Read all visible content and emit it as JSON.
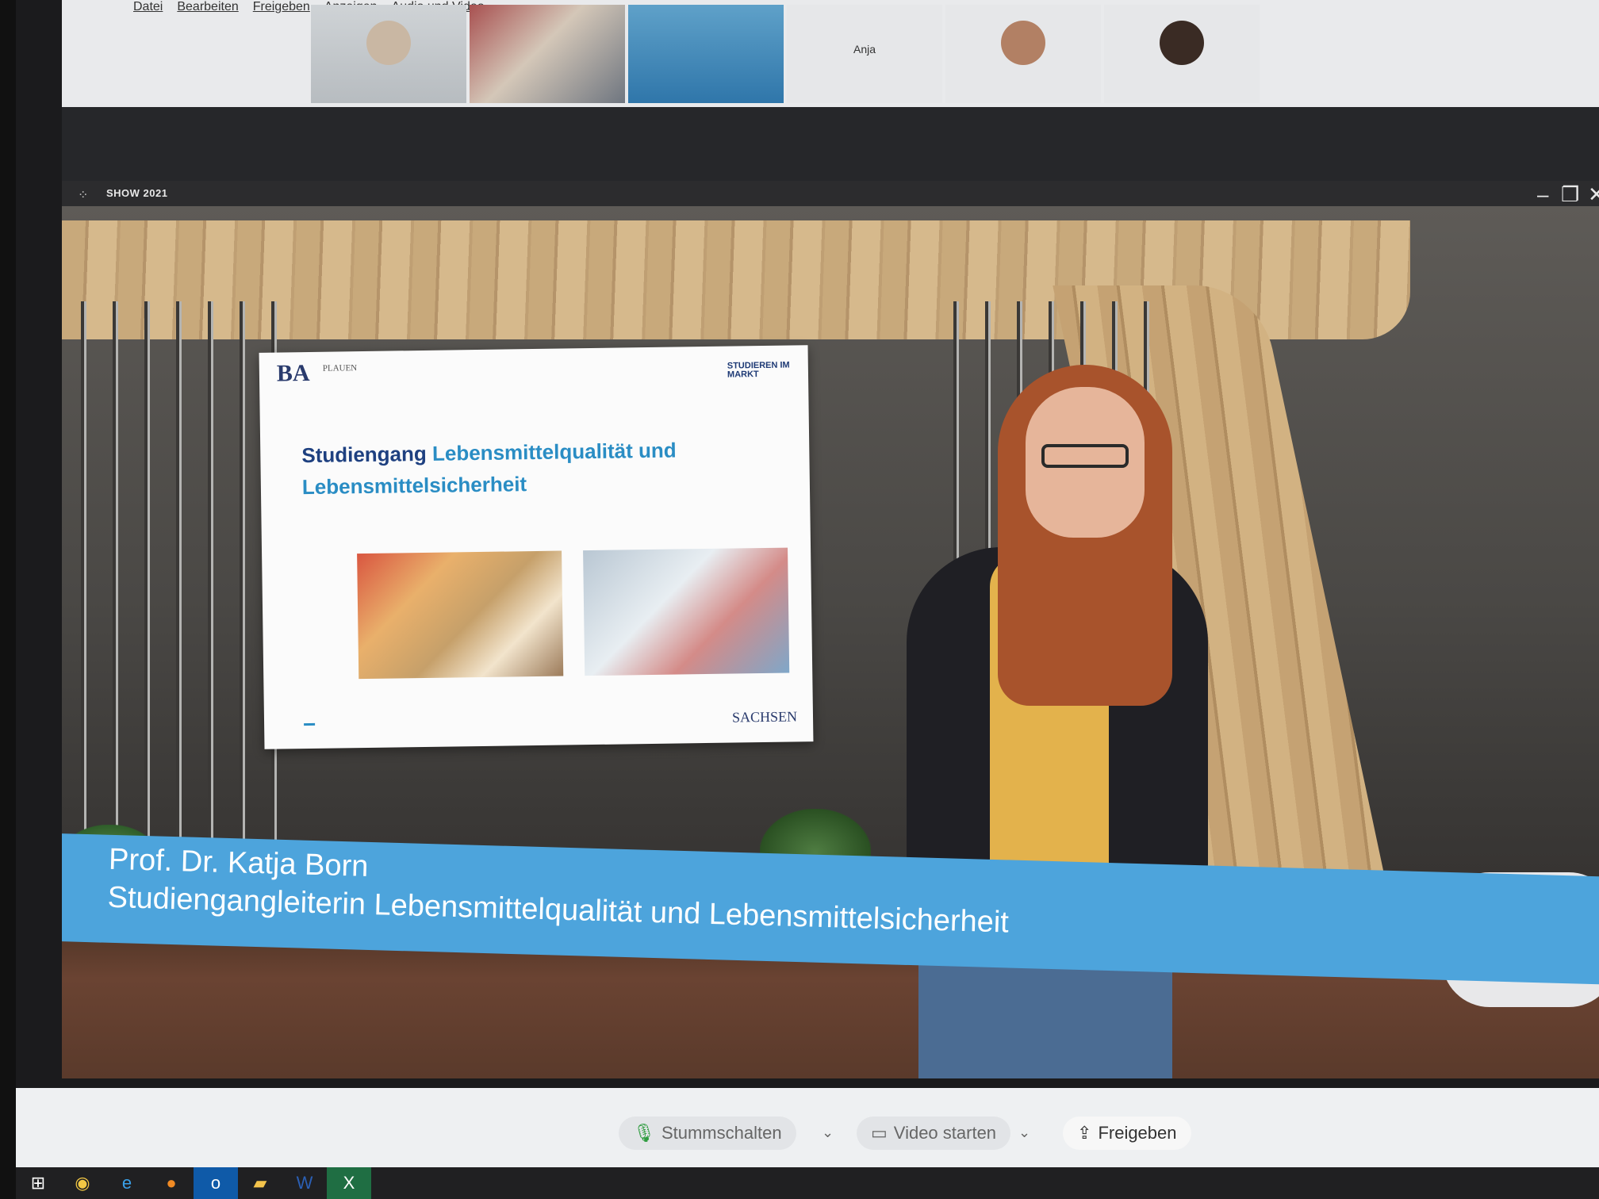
{
  "menu": {
    "items": [
      "Datei",
      "Bearbeiten",
      "Freigeben",
      "Anzeigen",
      "Audio und Video"
    ]
  },
  "participants": {
    "name_tile": "Anja"
  },
  "video_window": {
    "title": "SHOW 2021",
    "controls": {
      "minimize": "–",
      "maximize": "❐",
      "close": "✕"
    }
  },
  "slide": {
    "logo": "BA",
    "logo_sub": "PLAUEN",
    "tag": "STUDIEREN IM MARKT",
    "title_prefix": "Studiengang",
    "title_accent": "Lebensmittelqualität und Lebensmittelsicherheit",
    "footer_logo": "SACHSEN"
  },
  "lower_third": {
    "name": "Prof. Dr. Katja Born",
    "role": "Studiengangleiterin Lebensmittelqualität und Lebensmittelsicherheit"
  },
  "controls": {
    "mute_label": "Stummschalten",
    "video_label": "Video starten",
    "share_label": "Freigeben"
  },
  "taskbar": {
    "icons": [
      "windows-start-icon",
      "chrome-icon",
      "edge-icon",
      "firefox-icon",
      "outlook-icon",
      "explorer-icon",
      "word-icon",
      "excel-icon"
    ]
  }
}
